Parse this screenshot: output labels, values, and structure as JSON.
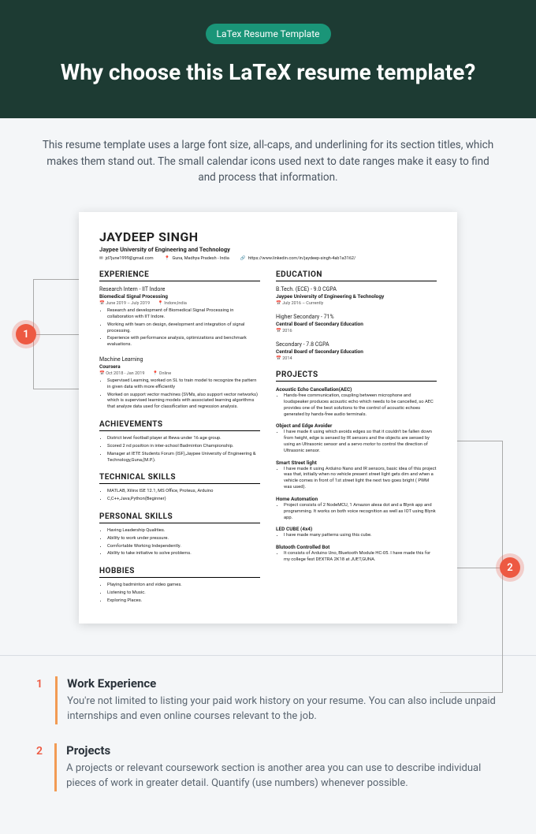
{
  "header": {
    "badge": "LaTex Resume Template",
    "title": "Why choose this LaTeX resume template?"
  },
  "intro": "This resume template uses a large font size, all-caps, and underlining for its section titles, which makes them stand out. The small calendar icons used next to date ranges make it easy to find and process that information.",
  "callout_numbers": {
    "left": "1",
    "right": "2"
  },
  "resume": {
    "name": "JAYDEEP SINGH",
    "subtitle": "Jaypee University of Engineering and Technology",
    "contact": {
      "email": "jd7june1999@gmail.com",
      "location": "Guna, Madhya Pradesh - India",
      "link": "https://www.linkedin.com/in/jaydeep-singh-4ab1a3162/"
    },
    "sections": {
      "experience": "EXPERIENCE",
      "achievements": "ACHIEVEMENTS",
      "technical_skills": "TECHNICAL SKILLS",
      "personal_skills": "PERSONAL SKILLS",
      "hobbies": "HOBBIES",
      "education": "EDUCATION",
      "projects": "PROJECTS"
    },
    "experience": [
      {
        "role": "Research Intern - IIT Indore",
        "org": "Biomedical Signal Processing",
        "date": "June 2019 – July 2019",
        "loc": "Indore,India",
        "bullets": [
          "Research and development of Biomedical Signal Processing in collaboration with IIT Indore.",
          "Working with team on design, development and integration of signal processing.",
          "Experience with performance analysis, optimizations and benchmark evaluations."
        ]
      },
      {
        "role": "Machine Learning",
        "org": "Coursera",
        "date": "Oct 2018 - Jan 2019",
        "loc": "Online",
        "bullets": [
          "Supervised Learning, worked on SL to train model to recognize the pattern in given data with more efficiently",
          "Worked on support vector machines (SVMs, also support vector networks) which is supervised learning models with associated learning algorithms that analyze data used for classification and regression analysis."
        ]
      }
    ],
    "achievements": [
      "District level football player at Rewa under 16 age group.",
      "Scored 2 nd position in inter-school Badminton Championship.",
      "Manager at IETE Students Forum (ISF),Jaypee University of Engineering & Technology,Guna,(M.P.)."
    ],
    "technical_skills": [
      "MATLAB, Xilinx ISE 12.1, MS Office, Proteus, Arduino",
      "C,C++,Java,Python(Beginner)"
    ],
    "personal_skills": [
      "Having Leadership Qualities.",
      "Ability to work under pressure.",
      "Comfortable Working Independently.",
      "Ability to take initiative to solve problems."
    ],
    "hobbies": [
      "Playing badminton and video games.",
      "Listening to Music.",
      "Exploring Places."
    ],
    "education": [
      {
        "role": "B.Tech. (ECE) - 9.0 CGPA",
        "org": "Jaypee University of Engineering & Technology",
        "date": "July 2016 – Currently"
      },
      {
        "role": "Higher Secondary - 71%",
        "org": "Central Board of Secondary Education",
        "date": "2016"
      },
      {
        "role": "Secondary - 7.8 CGPA",
        "org": "Central Board of Secondary Education",
        "date": "2014"
      }
    ],
    "projects": [
      {
        "t": "Acoustic Echo Cancellation(AEC)",
        "b": "Hands-free communication, coupling between microphone and loudspeaker produces acoustic echo which needs to be cancelled, so AEC provides one of the best solutions to the control of acoustic echoes generated by hands-free audio terminals."
      },
      {
        "t": "Object and Edge Avoider",
        "b": "I have made it using which avoids edges so that it couldn't be fallen down from height, edge is sensed by IR sensors and the objects are sensed by using an Ultrasonic sensor and a servo motor to control the direction of Ultrasonic sensor."
      },
      {
        "t": "Smart Street light",
        "b": "I have made it using Arduino Nano and IR sensors, basic idea of this project was that, initially when no vehicle present street light gets dim and when a vehicle comes in front of 1st street light the next two goes bright ( PWM was used)."
      },
      {
        "t": "Home Automation",
        "b": "Project consists of 2 NodeMCU, 1 Amazon alexa dot and a Blynk app and programming. It works on both voice recognition as well as IOT using Blynk app."
      },
      {
        "t": "LED CUBE (4x4)",
        "b": "I have made many patterns using this cube."
      },
      {
        "t": "Blutooth Controlled Bot",
        "b": "It consists of Arduino Uno, Bluetooth Module HC-05. I have made this for my college fest DEXTRA 2K18 at JUET,GUNA."
      }
    ]
  },
  "annotations": [
    {
      "num": "1",
      "title": "Work Experience",
      "text": "You're not limited to listing your paid work history on your resume. You can also include unpaid internships and even online courses relevant to the job."
    },
    {
      "num": "2",
      "title": "Projects",
      "text": "A projects or relevant coursework section is another area you can use to describe individual pieces of work in greater detail. Quantify (use numbers) whenever possible."
    }
  ]
}
